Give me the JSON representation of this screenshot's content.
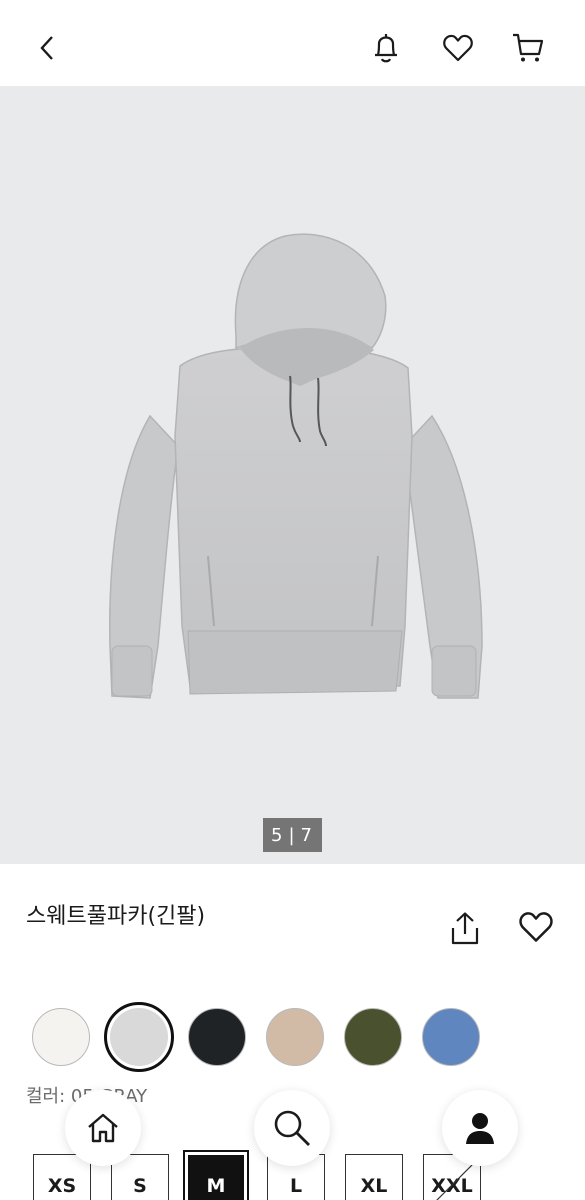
{
  "header": {
    "back_icon": "chevron-left-icon",
    "bell_icon": "bell-icon",
    "heart_icon": "heart-icon",
    "cart_icon": "cart-icon"
  },
  "gallery": {
    "current": "5",
    "separator": "|",
    "total": "7"
  },
  "product": {
    "title": "스웨트풀파카(긴팔)",
    "share_icon": "share-icon",
    "wishlist_icon": "heart-icon"
  },
  "colors": {
    "swatches": [
      {
        "hex": "#f5f3ef"
      },
      {
        "hex": "#d9d9da",
        "selected": true
      },
      {
        "hex": "#1f2326"
      },
      {
        "hex": "#d2bba6"
      },
      {
        "hex": "#4a512e"
      },
      {
        "hex": "#5f86be"
      }
    ],
    "label": "컬러: 05 GRAY"
  },
  "sizes": [
    {
      "label": "XS"
    },
    {
      "label": "S"
    },
    {
      "label": "M",
      "selected": true
    },
    {
      "label": "L"
    },
    {
      "label": "XL"
    },
    {
      "label": "XXL",
      "disabled": true
    }
  ],
  "bottom_nav": {
    "home_icon": "home-icon",
    "search_icon": "search-icon",
    "profile_icon": "user-icon"
  }
}
